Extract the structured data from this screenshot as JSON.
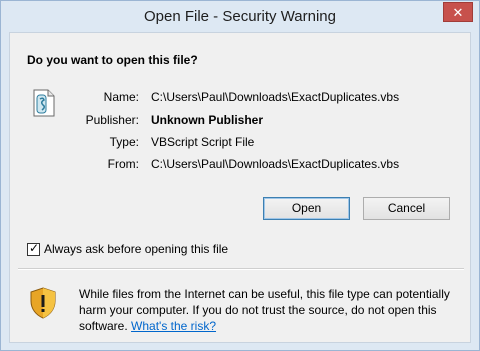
{
  "window": {
    "title": "Open File - Security Warning",
    "close_glyph": "✕"
  },
  "dialog": {
    "question": "Do you want to open this file?",
    "fields": [
      {
        "label": "Name:",
        "value": "C:\\Users\\Paul\\Downloads\\ExactDuplicates.vbs"
      },
      {
        "label": "Publisher:",
        "value": "Unknown Publisher"
      },
      {
        "label": "Type:",
        "value": "VBScript Script File"
      },
      {
        "label": "From:",
        "value": "C:\\Users\\Paul\\Downloads\\ExactDuplicates.vbs"
      }
    ],
    "open_label": "Open",
    "cancel_label": "Cancel",
    "always_ask_label": "Always ask before opening this file",
    "always_ask_checked": true,
    "warning_text": "While files from the Internet can be useful, this file type can potentially harm your computer. If you do not trust the source, do not open this software.",
    "risk_link": "What's the risk?"
  },
  "icons": {
    "file": "vbscript-file-icon",
    "shield": "security-shield-icon"
  }
}
